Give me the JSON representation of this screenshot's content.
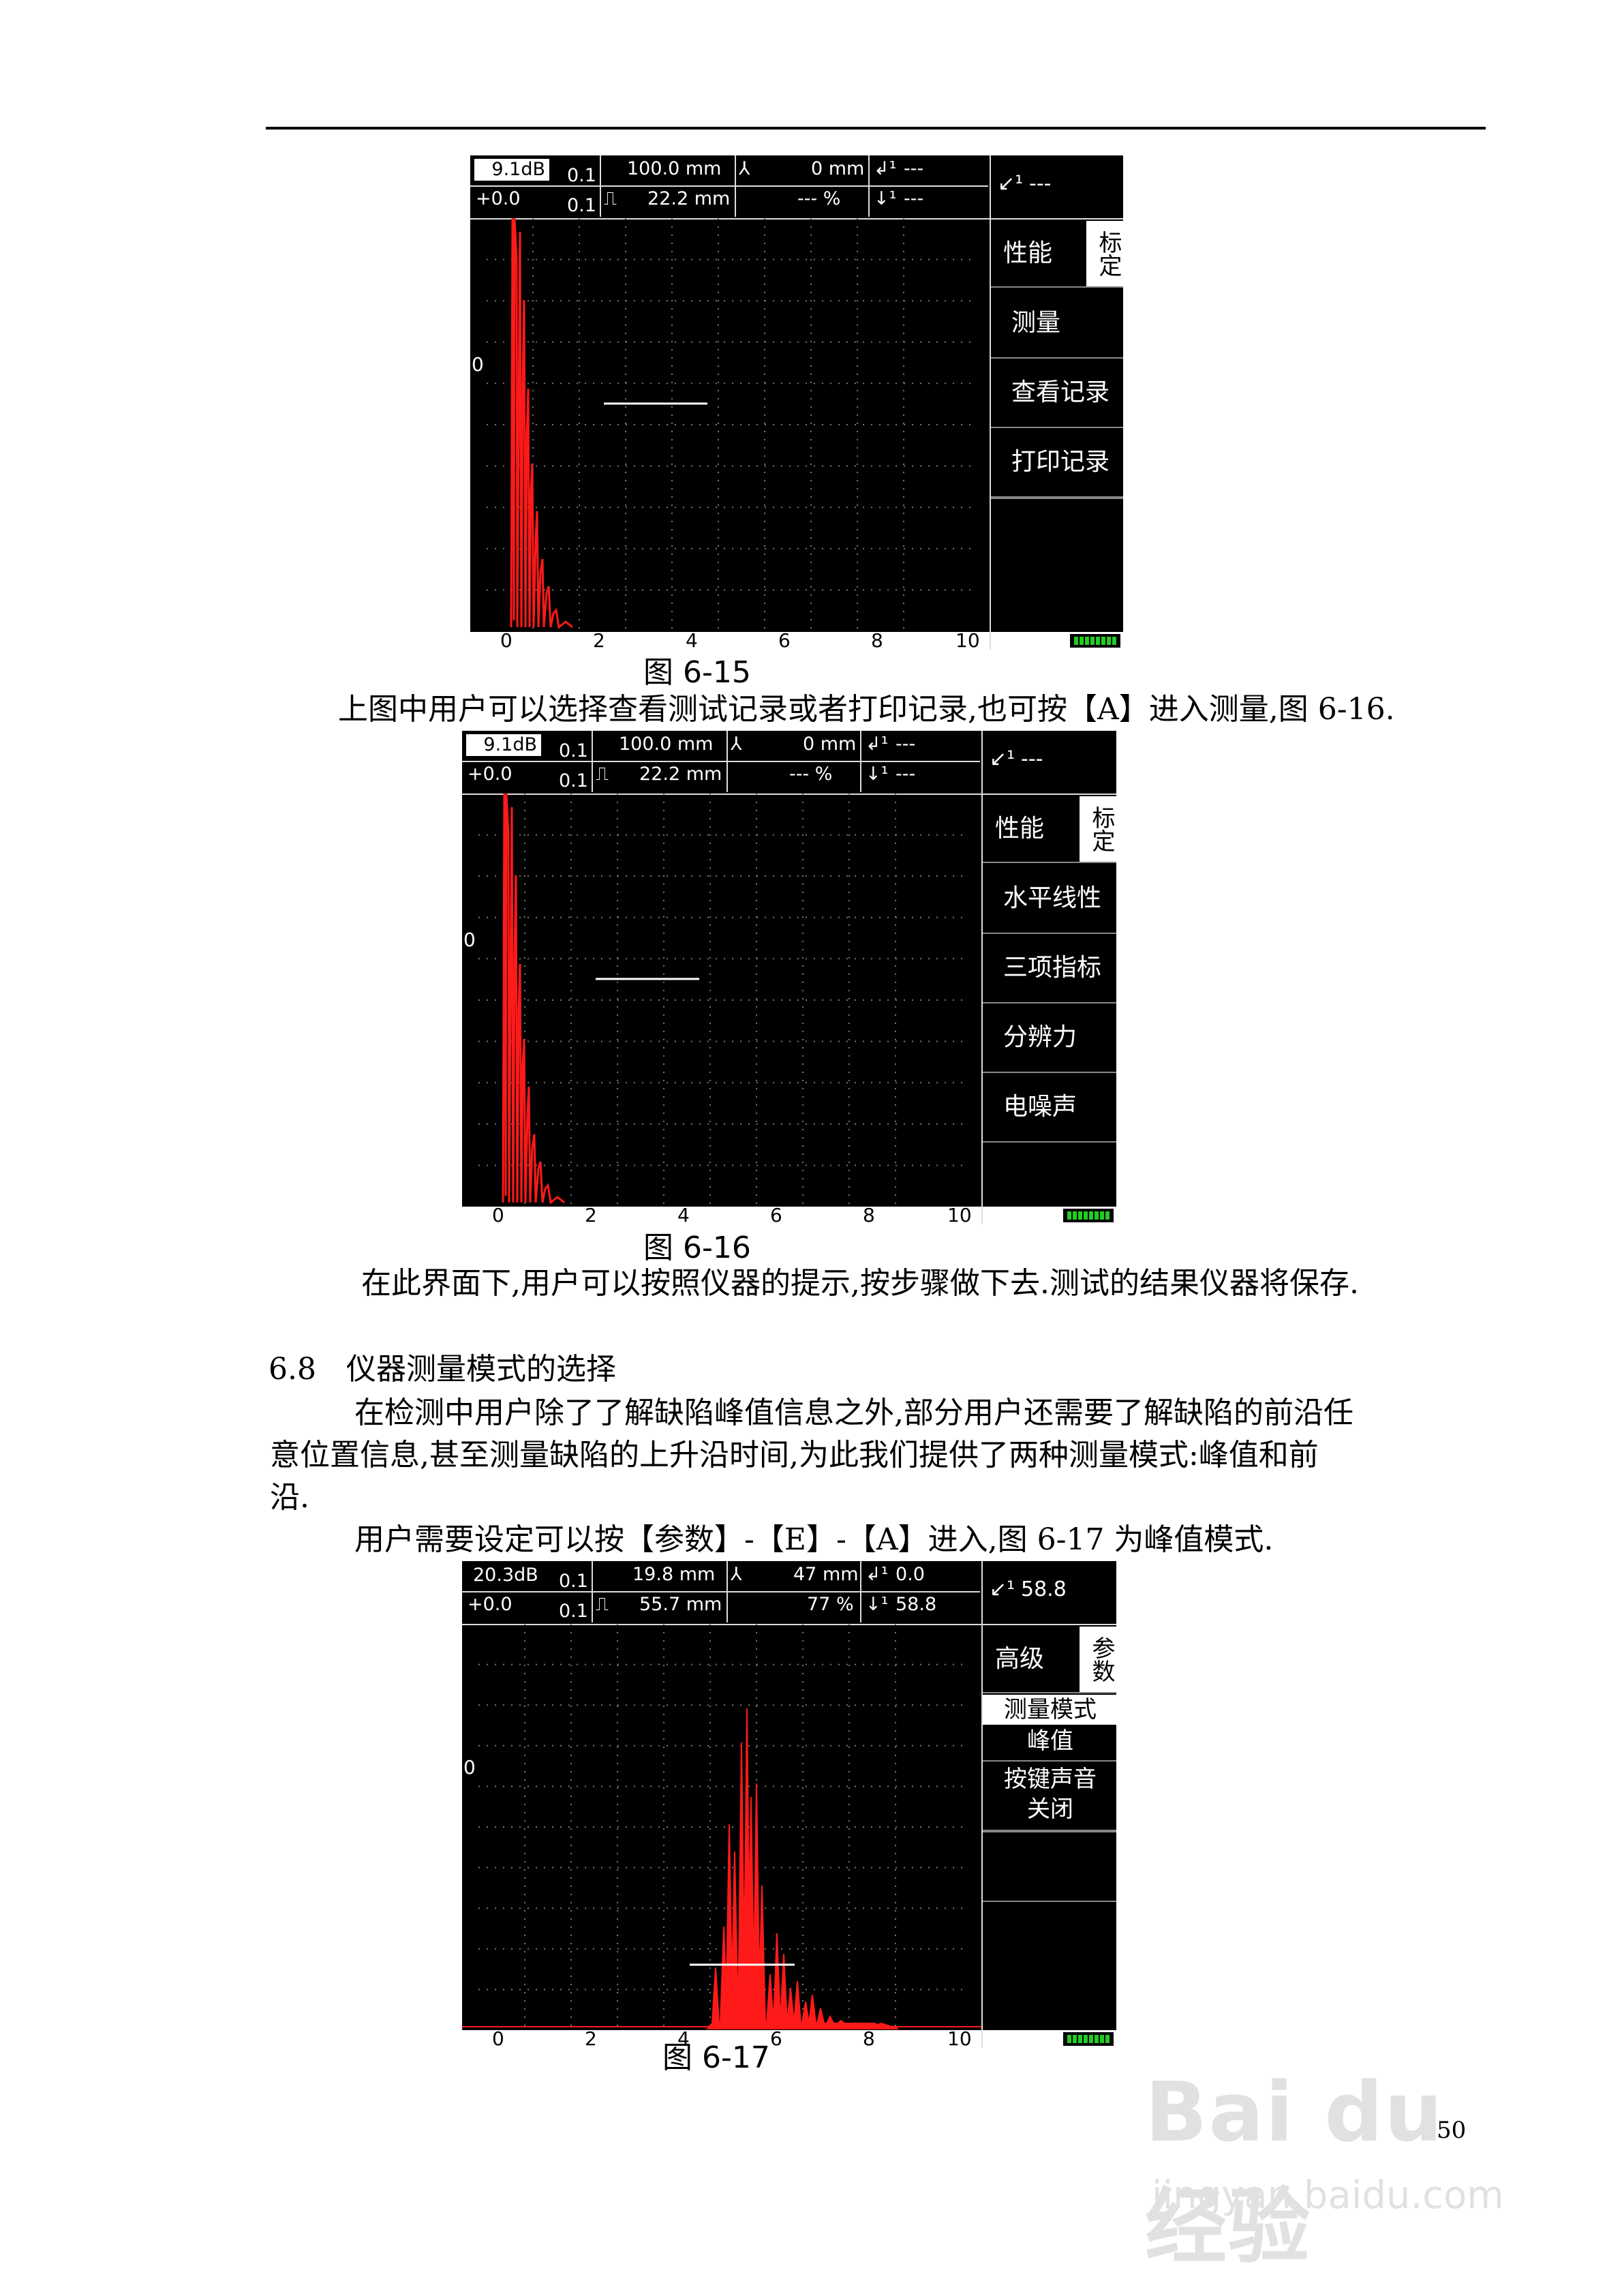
{
  "fig15": {
    "gain": "9.1dB",
    "offset": "+0.0",
    "step1": "0.1",
    "step2": "0.1",
    "range": "100.0 mm",
    "delay": "22.2 mm",
    "depth": "0 mm",
    "amp": "--- %",
    "s1": "---",
    "s2": "---",
    "s3": "---",
    "ylabel": "0",
    "menu_tab": "标定",
    "menu_group": "性能",
    "menu": [
      "测量",
      "查看记录",
      "打印记录"
    ],
    "xticks": [
      "0",
      "2",
      "4",
      "6",
      "8",
      "10"
    ],
    "caption": "图 6-15"
  },
  "fig16": {
    "gain": "9.1dB",
    "offset": "+0.0",
    "step1": "0.1",
    "step2": "0.1",
    "range": "100.0 mm",
    "delay": "22.2 mm",
    "depth": "0 mm",
    "amp": "--- %",
    "s1": "---",
    "s2": "---",
    "s3": "---",
    "ylabel": "0",
    "menu_tab": "标定",
    "menu_group": "性能",
    "menu": [
      "水平线性",
      "三项指标",
      "分辨力",
      "电噪声"
    ],
    "xticks": [
      "0",
      "2",
      "4",
      "6",
      "8",
      "10"
    ],
    "caption": "图 6-16"
  },
  "fig17": {
    "gain": "20.3dB",
    "offset": "+0.0",
    "step1": "0.1",
    "step2": "0.1",
    "range": "19.8 mm",
    "delay": "55.7 mm",
    "depth": "47 mm",
    "amp": "77 %",
    "s1": "0.0",
    "s2": "58.8",
    "s3": "58.8",
    "ylabel": "0",
    "menu_tab": "参数",
    "menu_group": "高级",
    "mode_label": "测量模式",
    "mode_value": "峰值",
    "beep_label": "按键声音",
    "beep_value": "关闭",
    "xticks": [
      "0",
      "2",
      "4",
      "6",
      "8",
      "10"
    ],
    "caption": "图 6-17"
  },
  "text": {
    "p1": "上图中用户可以选择查看测试记录或者打印记录,也可按【A】进入测量,图 6-16.",
    "p2": "在此界面下,用户可以按照仪器的提示,按步骤做下去.测试的结果仪器将保存.",
    "section": "6.8　仪器测量模式的选择",
    "p3a": "在检测中用户除了了解缺陷峰值信息之外,部分用户还需要了解缺陷的前沿任",
    "p3b": "意位置信息,甚至测量缺陷的上升沿时间,为此我们提供了两种测量模式:峰值和前",
    "p3c": "沿.",
    "p4": "用户需要设定可以按【参数】-【E】-【A】进入,图 6-17 为峰值模式."
  },
  "page_number": "50",
  "watermark": {
    "logo": "Bai du 经验",
    "url": "jingyan.baidu.com"
  },
  "colors": {
    "echo": "#ff1a1a",
    "screen_bg": "#000000",
    "battery": "#22cc22"
  }
}
